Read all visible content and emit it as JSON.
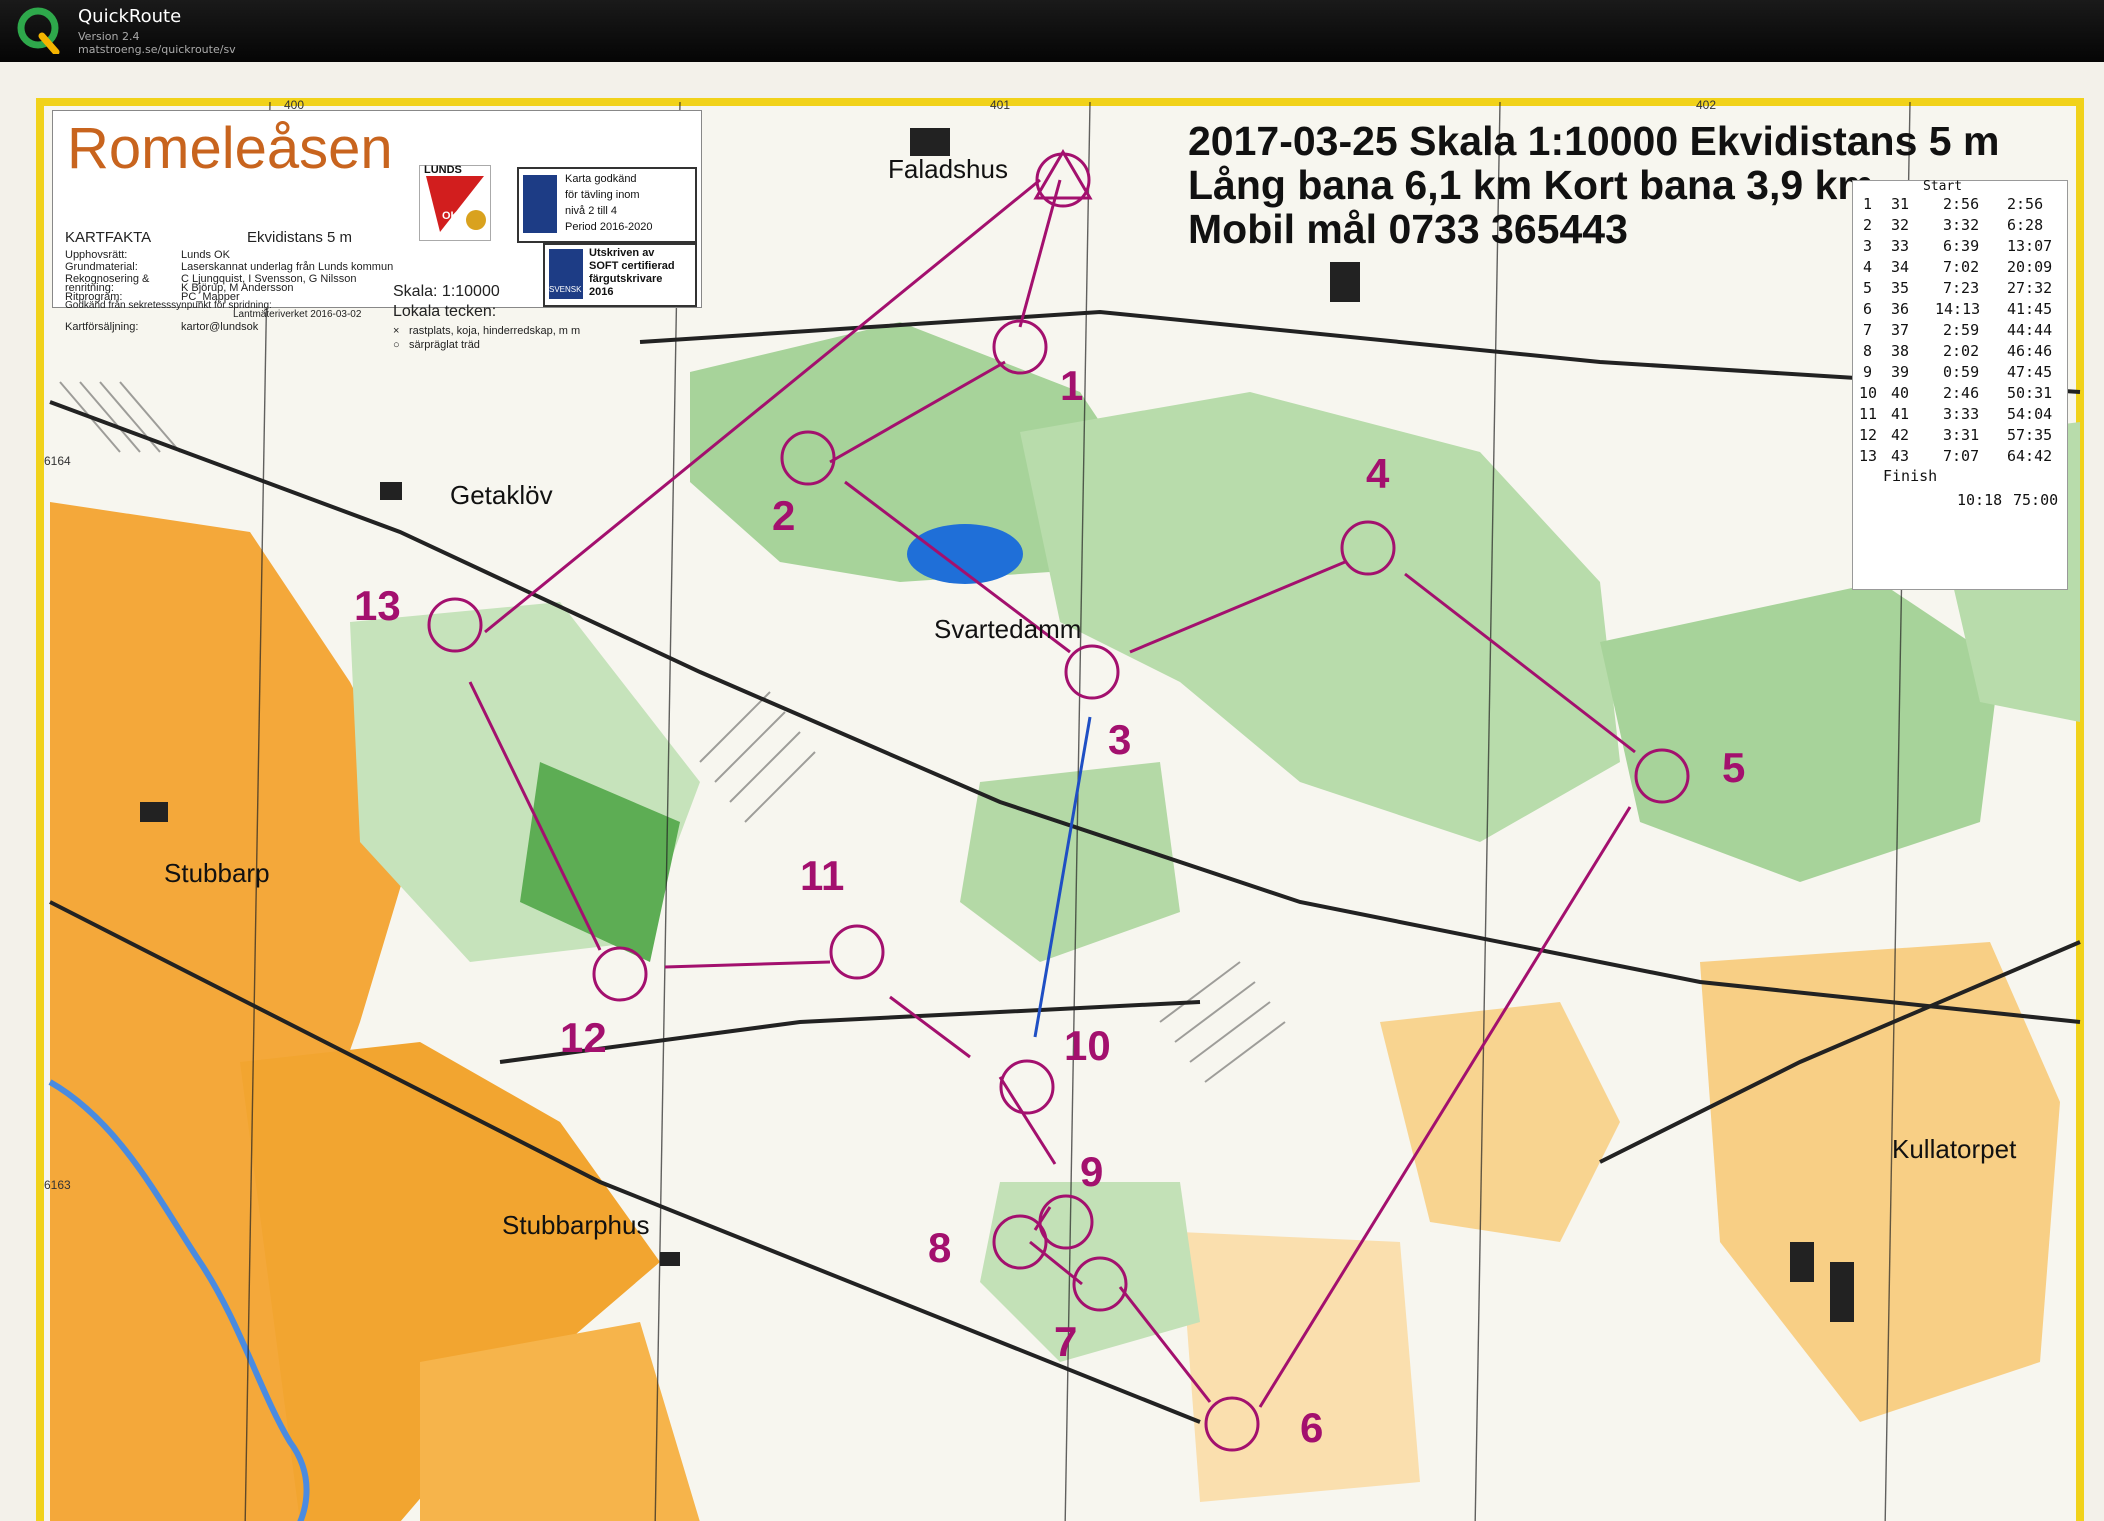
{
  "app": {
    "name": "QuickRoute",
    "version": "Version 2.4",
    "url": "matstroeng.se/quickroute/sv",
    "logo_letter": "Q"
  },
  "map": {
    "title": "Romeleåsen",
    "header": {
      "line1": "2017-03-25  Skala 1:10000  Ekvidistans 5 m",
      "line2": "Lång bana 6,1 km  Kort bana 3,9 km",
      "line3": "Mobil mål  0733 365443"
    },
    "legend": {
      "kartfakta": "KARTFAKTA",
      "ekvidistans": "Ekvidistans 5 m",
      "rows": [
        {
          "label": "Upphovsrätt:",
          "value": "Lunds OK"
        },
        {
          "label": "Grundmaterial:",
          "value": "Laserskannat underlag från Lunds kommun"
        },
        {
          "label": "Rekognosering &",
          "value": "C Ljungquist, I Svensson, G Nilsson"
        },
        {
          "label": "renritning:",
          "value": "K Björup, M Andersson"
        },
        {
          "label": "Ritprogram:",
          "value": "PC_Mapper"
        },
        {
          "label": "Godkänd från sekretesssynpunkt för spridning:",
          "value": "Lantmäteriverket 2016-03-02"
        },
        {
          "label": "Kartförsäljning:",
          "value": "kartor@lundsok"
        }
      ],
      "scale": "Skala: 1:10000",
      "lokala": "Lokala tecken:",
      "sym1": "rastplats, koja, hinderredskap, m m",
      "sym2": "särpräglat träd",
      "club_logo": "LUNDS",
      "club_logo2": "OK",
      "approved_line1": "Karta godkänd",
      "approved_line2": "för tävling inom",
      "approved_line3": "nivå 2 till 4",
      "approved_line4": "Period 2016-2020",
      "soft_line1": "Utskriven av",
      "soft_line2": "SOFT certifierad",
      "soft_line3": "färgutskrivare",
      "soft_line4": "2016",
      "soft_brand": "SVENSK"
    },
    "place_names": {
      "faladshus": "Faladshus",
      "getaklov": "Getaklöv",
      "svartedamm": "Svartedamm",
      "stubbarp": "Stubbarp",
      "stubbarphus": "Stubbarphus",
      "kullatorpet": "Kullatorpet"
    },
    "grid_numbers": {
      "g400": "400",
      "g401": "401",
      "g402": "402",
      "g6164": "6164",
      "g6163": "6163"
    },
    "controls": [
      "1",
      "2",
      "3",
      "4",
      "5",
      "6",
      "7",
      "8",
      "9",
      "10",
      "11",
      "12",
      "13"
    ],
    "splits": {
      "start_label": "Start",
      "rows": [
        {
          "n": "1",
          "code": "31",
          "split": "2:56",
          "total": "2:56"
        },
        {
          "n": "2",
          "code": "32",
          "split": "3:32",
          "total": "6:28"
        },
        {
          "n": "3",
          "code": "33",
          "split": "6:39",
          "total": "13:07"
        },
        {
          "n": "4",
          "code": "34",
          "split": "7:02",
          "total": "20:09"
        },
        {
          "n": "5",
          "code": "35",
          "split": "7:23",
          "total": "27:32"
        },
        {
          "n": "6",
          "code": "36",
          "split": "14:13",
          "total": "41:45"
        },
        {
          "n": "7",
          "code": "37",
          "split": "2:59",
          "total": "44:44"
        },
        {
          "n": "8",
          "code": "38",
          "split": "2:02",
          "total": "46:46"
        },
        {
          "n": "9",
          "code": "39",
          "split": "0:59",
          "total": "47:45"
        },
        {
          "n": "10",
          "code": "40",
          "split": "2:46",
          "total": "50:31"
        },
        {
          "n": "11",
          "code": "41",
          "split": "3:33",
          "total": "54:04"
        },
        {
          "n": "12",
          "code": "42",
          "split": "3:31",
          "total": "57:35"
        },
        {
          "n": "13",
          "code": "43",
          "split": "7:07",
          "total": "64:42"
        }
      ],
      "finish_label": "Finish",
      "finish_split": "10:18",
      "finish_total": "75:00"
    },
    "colors": {
      "course": "#a3106e",
      "route": "#1f4fc4",
      "forest_green": "#a7d39a",
      "open_yellow": "#f4a83a",
      "lake_blue": "#1f6fd8"
    }
  }
}
